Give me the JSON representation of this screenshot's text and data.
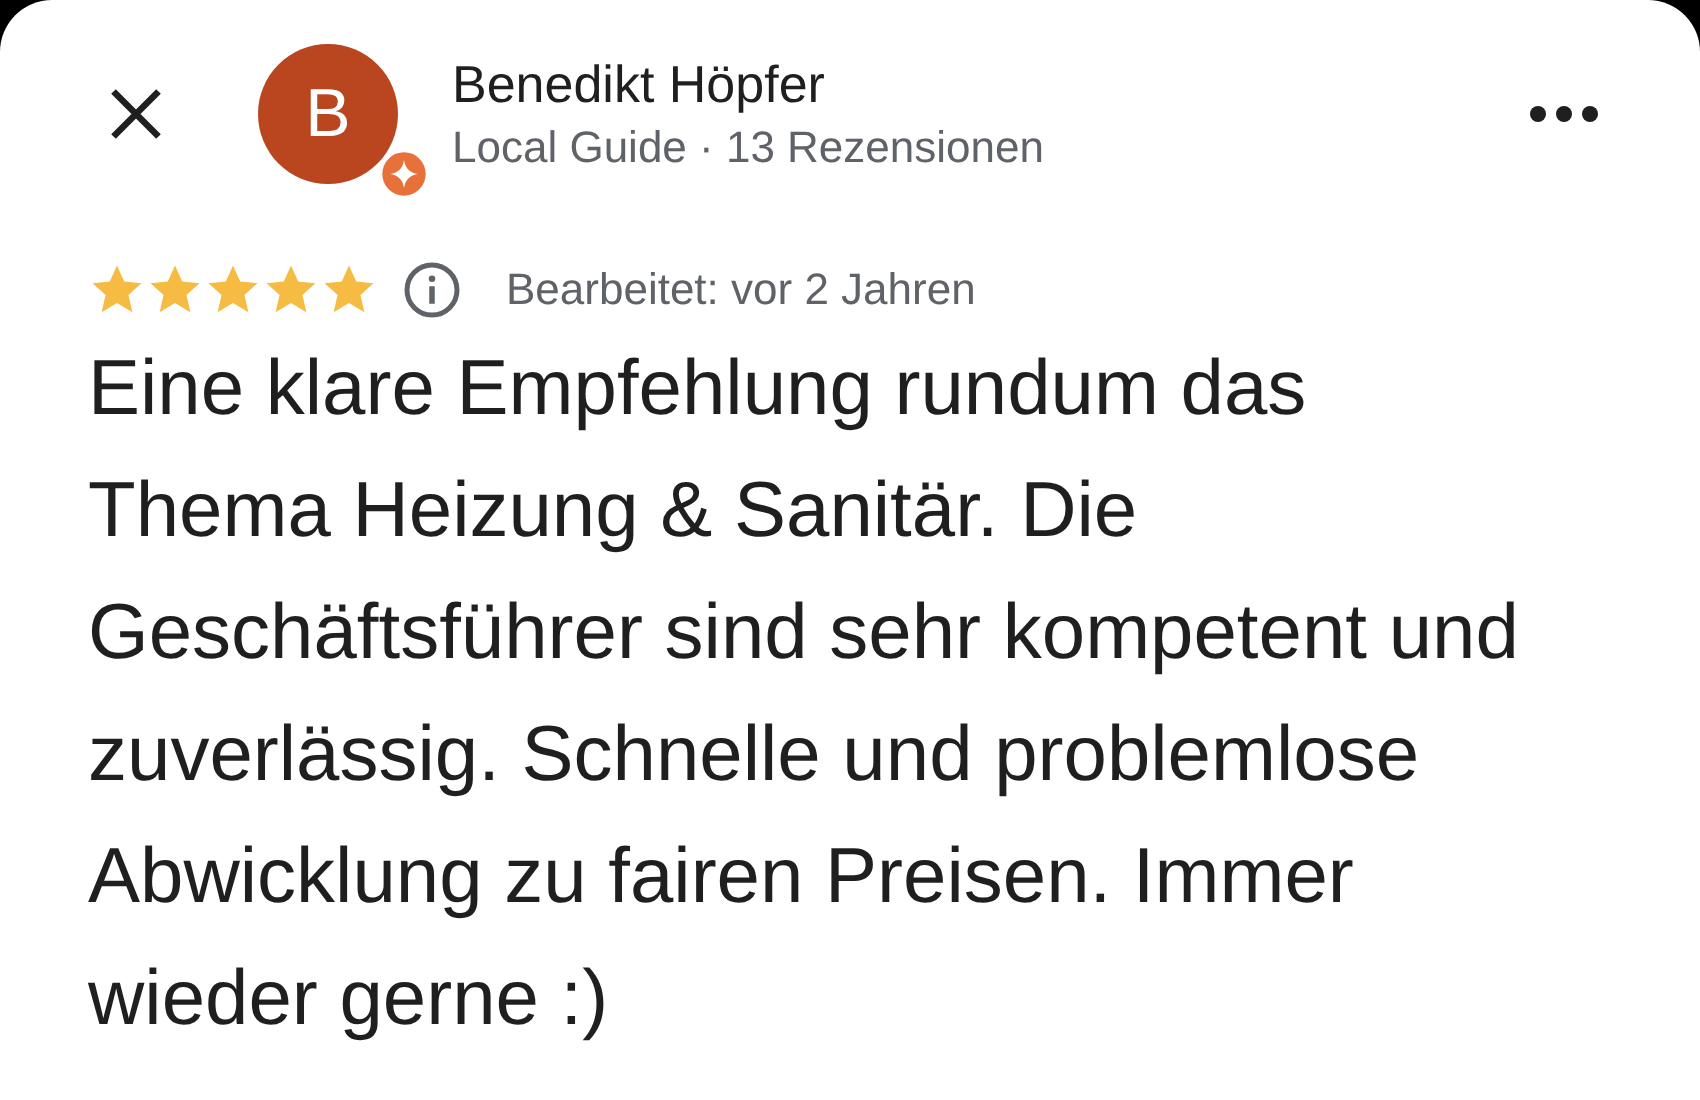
{
  "reviewer": {
    "initial": "B",
    "name": "Benedikt Höpfer",
    "subtitle": "Local Guide · 13 Rezensionen",
    "local_guide": true
  },
  "review": {
    "stars": 5,
    "edited": "Bearbeitet: vor 2 Jahren",
    "text": "Eine klare Empfehlung rundum das Thema Heizung & Sanitär. Die Geschäftsführer sind sehr kompetent und zuverlässig. Schnelle und problemlose Abwicklung zu fairen Preisen. Immer wieder gerne :)"
  }
}
